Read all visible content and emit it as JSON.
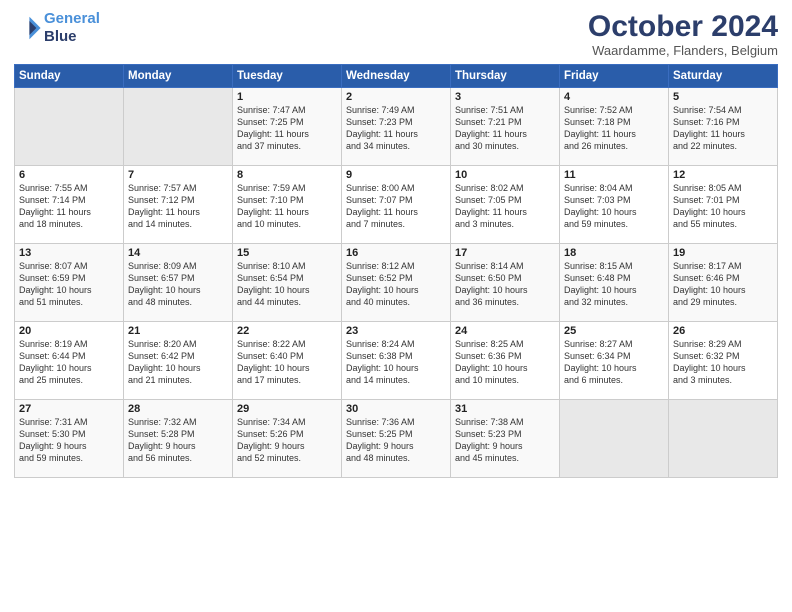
{
  "header": {
    "logo_line1": "General",
    "logo_line2": "Blue",
    "title": "October 2024",
    "subtitle": "Waardamme, Flanders, Belgium"
  },
  "weekdays": [
    "Sunday",
    "Monday",
    "Tuesday",
    "Wednesday",
    "Thursday",
    "Friday",
    "Saturday"
  ],
  "weeks": [
    [
      {
        "day": "",
        "info": ""
      },
      {
        "day": "",
        "info": ""
      },
      {
        "day": "1",
        "info": "Sunrise: 7:47 AM\nSunset: 7:25 PM\nDaylight: 11 hours\nand 37 minutes."
      },
      {
        "day": "2",
        "info": "Sunrise: 7:49 AM\nSunset: 7:23 PM\nDaylight: 11 hours\nand 34 minutes."
      },
      {
        "day": "3",
        "info": "Sunrise: 7:51 AM\nSunset: 7:21 PM\nDaylight: 11 hours\nand 30 minutes."
      },
      {
        "day": "4",
        "info": "Sunrise: 7:52 AM\nSunset: 7:18 PM\nDaylight: 11 hours\nand 26 minutes."
      },
      {
        "day": "5",
        "info": "Sunrise: 7:54 AM\nSunset: 7:16 PM\nDaylight: 11 hours\nand 22 minutes."
      }
    ],
    [
      {
        "day": "6",
        "info": "Sunrise: 7:55 AM\nSunset: 7:14 PM\nDaylight: 11 hours\nand 18 minutes."
      },
      {
        "day": "7",
        "info": "Sunrise: 7:57 AM\nSunset: 7:12 PM\nDaylight: 11 hours\nand 14 minutes."
      },
      {
        "day": "8",
        "info": "Sunrise: 7:59 AM\nSunset: 7:10 PM\nDaylight: 11 hours\nand 10 minutes."
      },
      {
        "day": "9",
        "info": "Sunrise: 8:00 AM\nSunset: 7:07 PM\nDaylight: 11 hours\nand 7 minutes."
      },
      {
        "day": "10",
        "info": "Sunrise: 8:02 AM\nSunset: 7:05 PM\nDaylight: 11 hours\nand 3 minutes."
      },
      {
        "day": "11",
        "info": "Sunrise: 8:04 AM\nSunset: 7:03 PM\nDaylight: 10 hours\nand 59 minutes."
      },
      {
        "day": "12",
        "info": "Sunrise: 8:05 AM\nSunset: 7:01 PM\nDaylight: 10 hours\nand 55 minutes."
      }
    ],
    [
      {
        "day": "13",
        "info": "Sunrise: 8:07 AM\nSunset: 6:59 PM\nDaylight: 10 hours\nand 51 minutes."
      },
      {
        "day": "14",
        "info": "Sunrise: 8:09 AM\nSunset: 6:57 PM\nDaylight: 10 hours\nand 48 minutes."
      },
      {
        "day": "15",
        "info": "Sunrise: 8:10 AM\nSunset: 6:54 PM\nDaylight: 10 hours\nand 44 minutes."
      },
      {
        "day": "16",
        "info": "Sunrise: 8:12 AM\nSunset: 6:52 PM\nDaylight: 10 hours\nand 40 minutes."
      },
      {
        "day": "17",
        "info": "Sunrise: 8:14 AM\nSunset: 6:50 PM\nDaylight: 10 hours\nand 36 minutes."
      },
      {
        "day": "18",
        "info": "Sunrise: 8:15 AM\nSunset: 6:48 PM\nDaylight: 10 hours\nand 32 minutes."
      },
      {
        "day": "19",
        "info": "Sunrise: 8:17 AM\nSunset: 6:46 PM\nDaylight: 10 hours\nand 29 minutes."
      }
    ],
    [
      {
        "day": "20",
        "info": "Sunrise: 8:19 AM\nSunset: 6:44 PM\nDaylight: 10 hours\nand 25 minutes."
      },
      {
        "day": "21",
        "info": "Sunrise: 8:20 AM\nSunset: 6:42 PM\nDaylight: 10 hours\nand 21 minutes."
      },
      {
        "day": "22",
        "info": "Sunrise: 8:22 AM\nSunset: 6:40 PM\nDaylight: 10 hours\nand 17 minutes."
      },
      {
        "day": "23",
        "info": "Sunrise: 8:24 AM\nSunset: 6:38 PM\nDaylight: 10 hours\nand 14 minutes."
      },
      {
        "day": "24",
        "info": "Sunrise: 8:25 AM\nSunset: 6:36 PM\nDaylight: 10 hours\nand 10 minutes."
      },
      {
        "day": "25",
        "info": "Sunrise: 8:27 AM\nSunset: 6:34 PM\nDaylight: 10 hours\nand 6 minutes."
      },
      {
        "day": "26",
        "info": "Sunrise: 8:29 AM\nSunset: 6:32 PM\nDaylight: 10 hours\nand 3 minutes."
      }
    ],
    [
      {
        "day": "27",
        "info": "Sunrise: 7:31 AM\nSunset: 5:30 PM\nDaylight: 9 hours\nand 59 minutes."
      },
      {
        "day": "28",
        "info": "Sunrise: 7:32 AM\nSunset: 5:28 PM\nDaylight: 9 hours\nand 56 minutes."
      },
      {
        "day": "29",
        "info": "Sunrise: 7:34 AM\nSunset: 5:26 PM\nDaylight: 9 hours\nand 52 minutes."
      },
      {
        "day": "30",
        "info": "Sunrise: 7:36 AM\nSunset: 5:25 PM\nDaylight: 9 hours\nand 48 minutes."
      },
      {
        "day": "31",
        "info": "Sunrise: 7:38 AM\nSunset: 5:23 PM\nDaylight: 9 hours\nand 45 minutes."
      },
      {
        "day": "",
        "info": ""
      },
      {
        "day": "",
        "info": ""
      }
    ]
  ]
}
